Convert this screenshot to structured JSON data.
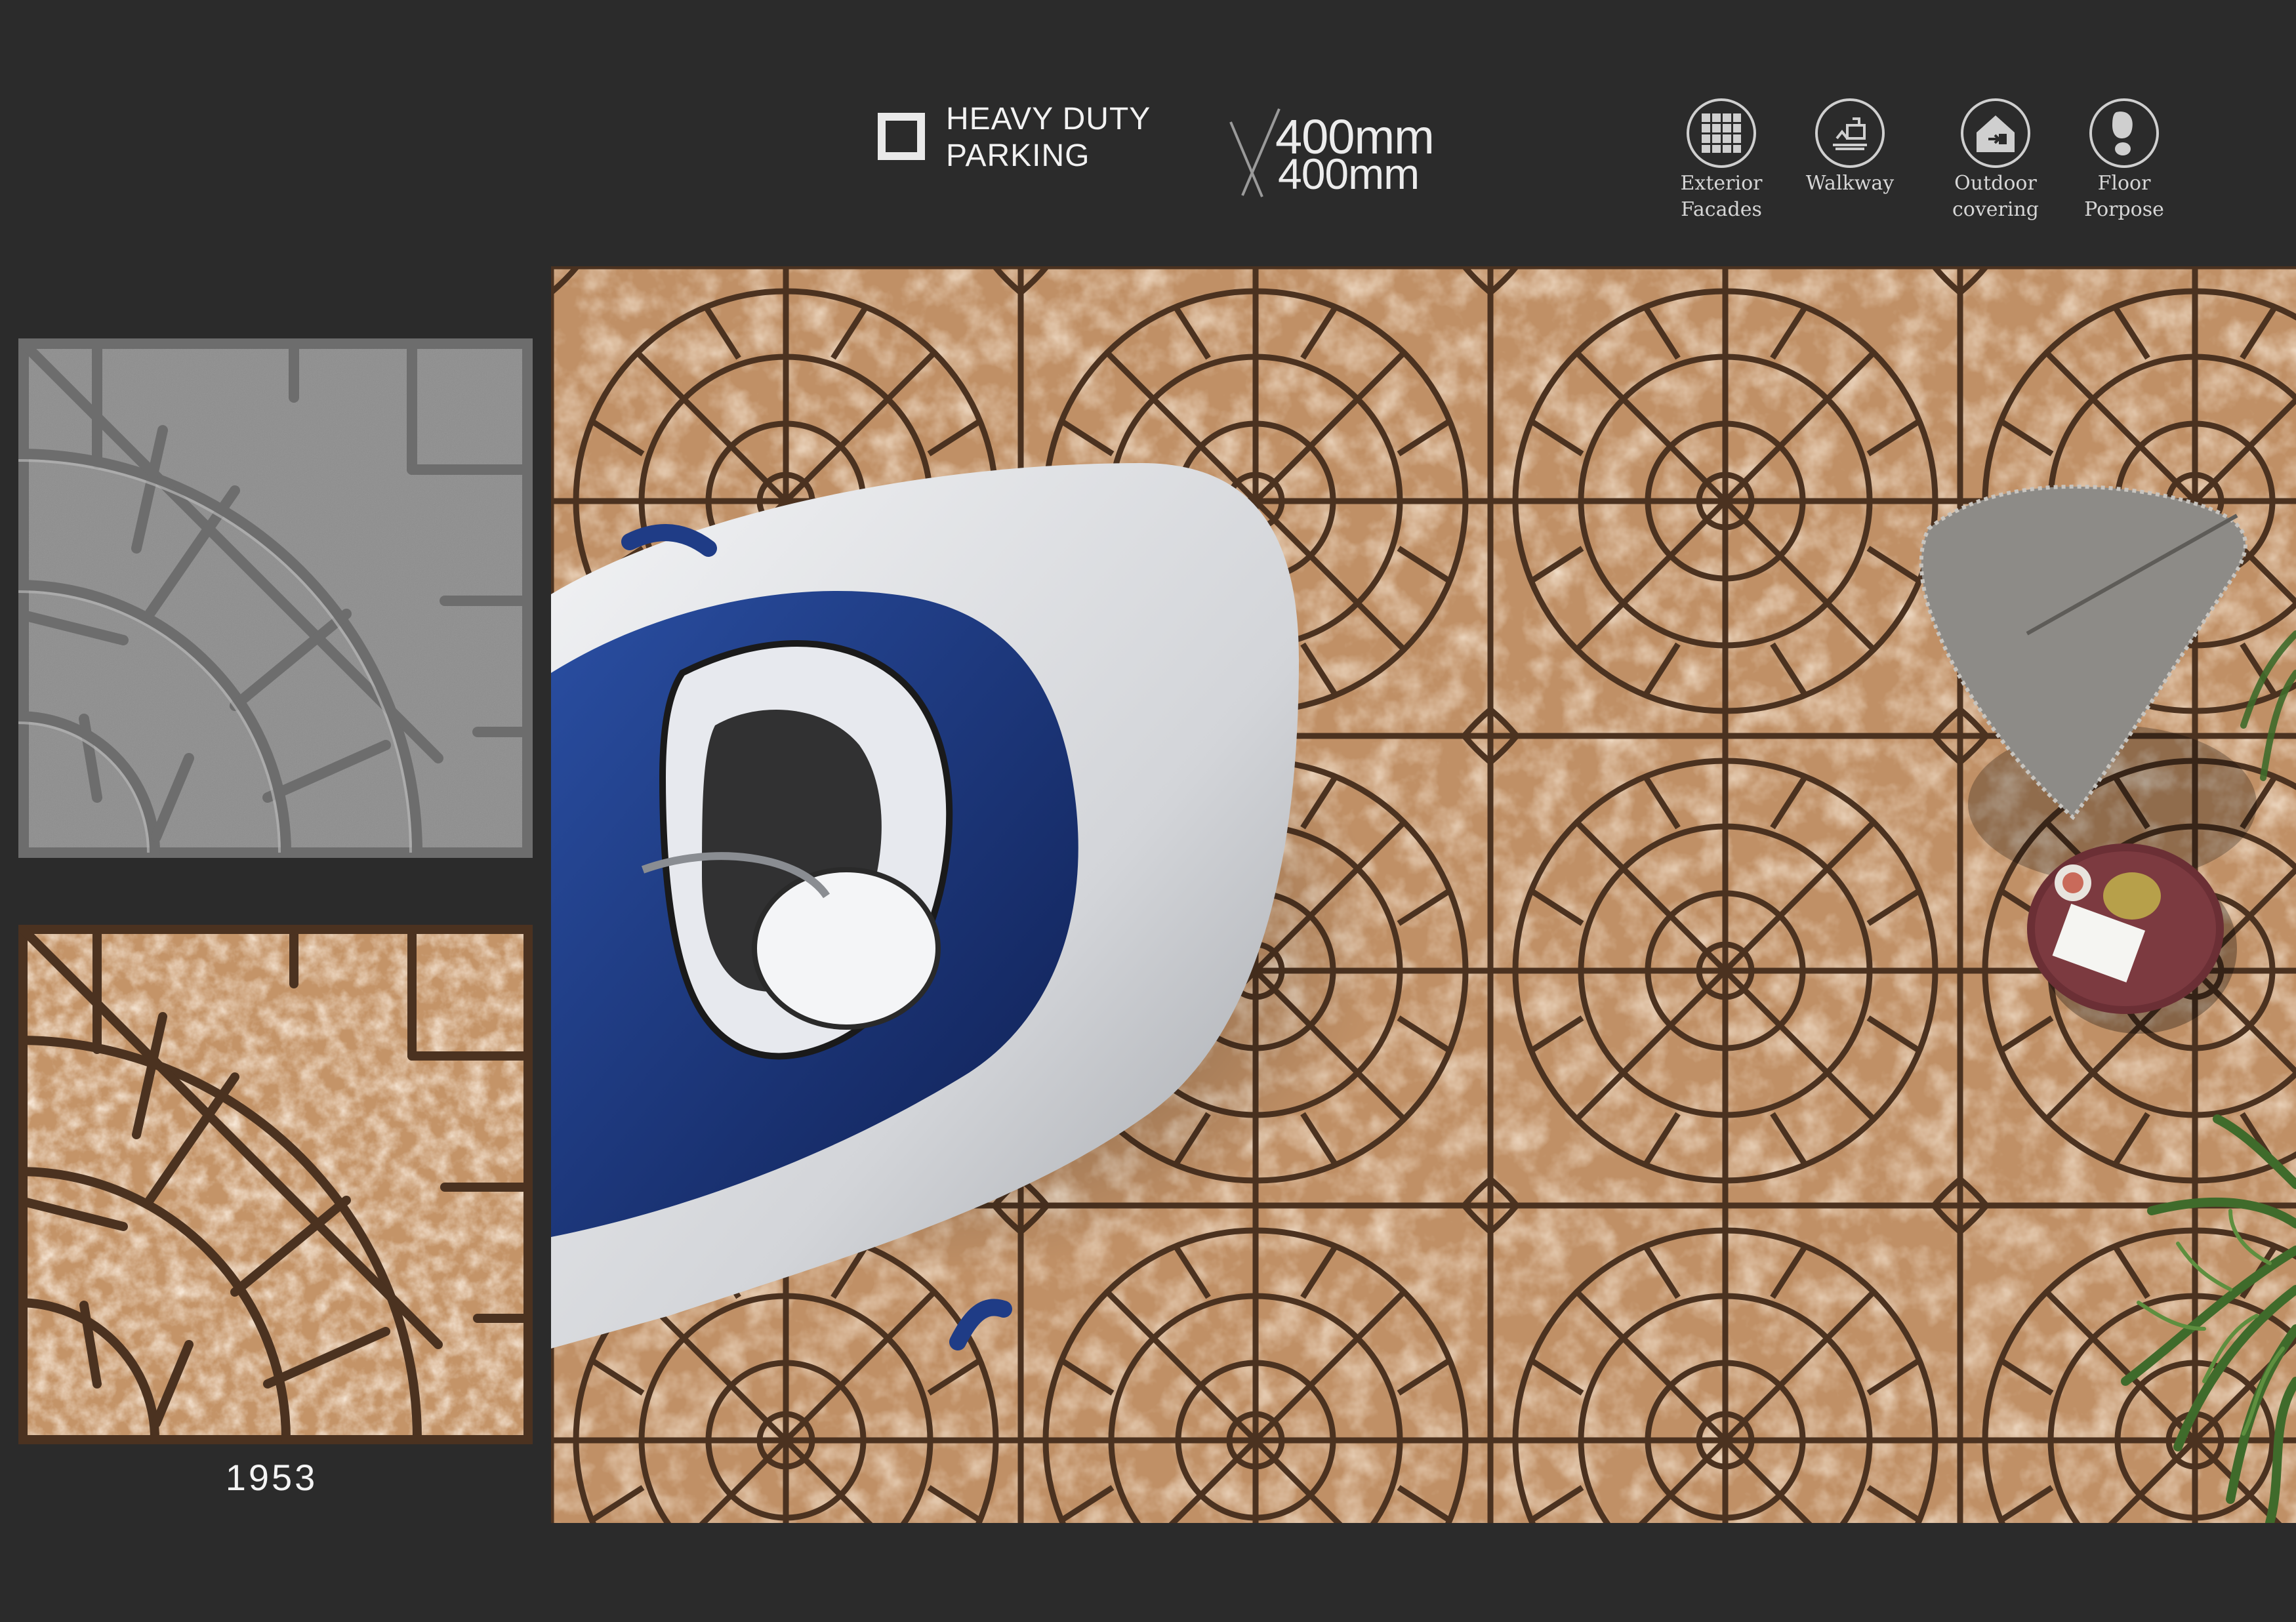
{
  "header": {
    "category_line1": "HEAVY DUTY",
    "category_line2": "PARKING",
    "size_width": "400mm",
    "size_height": "400mm"
  },
  "applications": [
    {
      "icon": "facade-grid-icon",
      "label_line1": "Exterior",
      "label_line2": "Facades"
    },
    {
      "icon": "walkway-icon",
      "label_line1": "Walkway",
      "label_line2": ""
    },
    {
      "icon": "outdoor-covering-icon",
      "label_line1": "Outdoor",
      "label_line2": "covering"
    },
    {
      "icon": "footprint-icon",
      "label_line1": "Floor",
      "label_line2": "Porpose"
    }
  ],
  "product": {
    "code": "1953"
  },
  "colors": {
    "background": "#2b2b2b",
    "tile_gray": "#8e8e8e",
    "tile_sand": "#c49468",
    "tile_grout": "#4b3220",
    "car_body": "#d9dbde",
    "car_blue": "#1f3c86"
  }
}
